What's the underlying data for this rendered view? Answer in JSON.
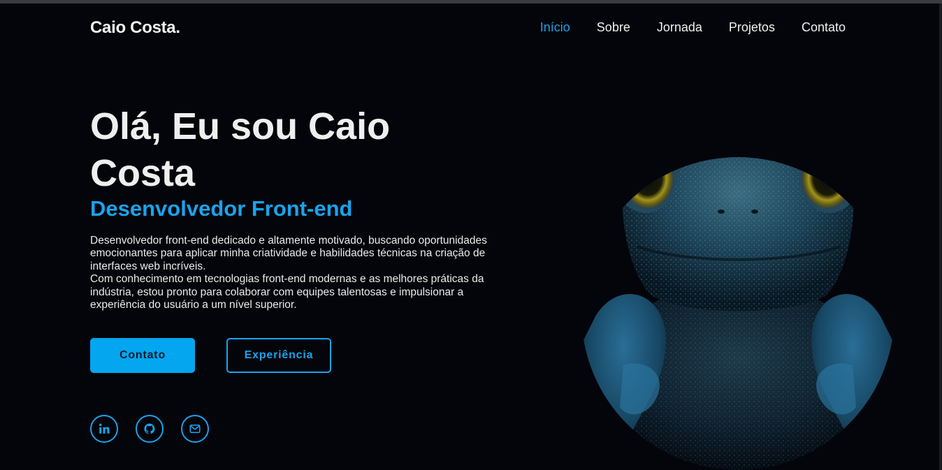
{
  "header": {
    "logo": "Caio Costa.",
    "nav": [
      "Início",
      "Sobre",
      "Jornada",
      "Projetos",
      "Contato"
    ],
    "active_index": 0
  },
  "hero": {
    "title": "Olá, Eu sou Caio Costa",
    "subtitle": "Desenvolvedor Front-end",
    "description_p1": "Desenvolvedor front-end dedicado e altamente motivado, buscando oportunidades emocionantes para aplicar minha criatividade e habilidades técnicas na criação de interfaces web incríveis.",
    "description_p2": "Com conhecimento em tecnologias front-end modernas e as melhores práticas da indústria, estou pronto para colaborar com equipes talentosas e impulsionar a experiência do usuário a um nível superior.",
    "buttons": {
      "primary": "Contato",
      "secondary": "Experiência"
    }
  },
  "socials": [
    {
      "icon": "linkedin-icon"
    },
    {
      "icon": "github-icon"
    },
    {
      "icon": "mail-icon"
    }
  ],
  "colors": {
    "background": "#04050a",
    "accent": "#1aa3ec",
    "button_fill": "#03a6ef",
    "text": "#efefef"
  }
}
